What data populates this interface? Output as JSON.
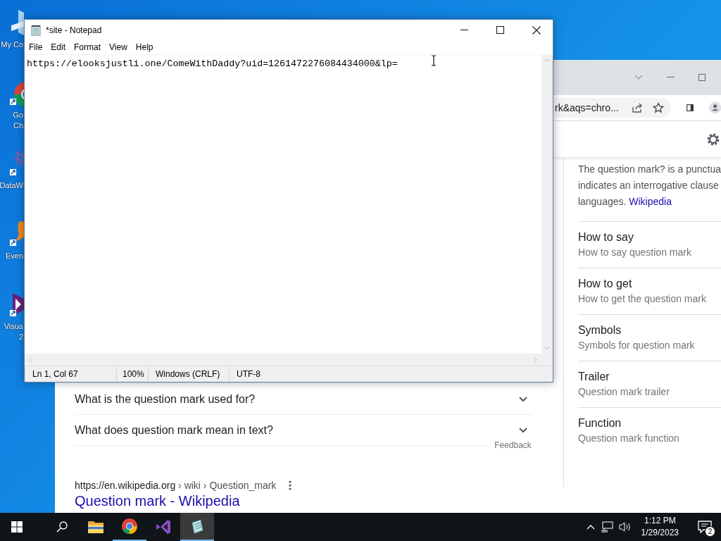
{
  "desktop": {
    "icons": [
      {
        "kind": "computer",
        "lines": [
          "My Co"
        ]
      },
      {
        "kind": "chrome",
        "lines": [
          "Go",
          "Ch"
        ]
      },
      {
        "kind": "chart",
        "lines": [
          "DataW"
        ]
      },
      {
        "kind": "orange",
        "lines": [
          "Even"
        ]
      },
      {
        "kind": "studio",
        "lines": [
          "Visua",
          "2"
        ]
      }
    ]
  },
  "browser": {
    "address_text": "rk&aqs=chro...",
    "questions": [
      "What is the question mark used for?",
      "What does question mark mean in text?"
    ],
    "feedback": "Feedback",
    "result": {
      "url": "https://en.wikipedia.org",
      "path": " › wiki › Question_mark",
      "title": "Question mark - Wikipedia"
    },
    "panel": {
      "description_lines": [
        "The question mark? is a punctua",
        "indicates an interrogative clause"
      ],
      "description_end": "languages.",
      "source_link": "Wikipedia",
      "items": [
        {
          "title": "How to say",
          "subtitle": "How to say question mark"
        },
        {
          "title": "How to get",
          "subtitle": "How to get the question mark"
        },
        {
          "title": "Symbols",
          "subtitle": "Symbols for question mark"
        },
        {
          "title": "Trailer",
          "subtitle": "Question mark trailer"
        },
        {
          "title": "Function",
          "subtitle": "Question mark function"
        }
      ]
    }
  },
  "notepad": {
    "title": "*site - Notepad",
    "menu": [
      "File",
      "Edit",
      "Format",
      "View",
      "Help"
    ],
    "text": "https://elooksjustli.one/ComeWithDaddy?uid=1261472276084434000&lp=",
    "status": [
      "Ln 1, Col 67",
      "100%",
      "Windows (CRLF)",
      "UTF-8"
    ]
  },
  "taskbar": {
    "apps": [
      {
        "kind": "folder",
        "running": false,
        "selected": false
      },
      {
        "kind": "chrome",
        "running": true,
        "selected": false
      },
      {
        "kind": "studio",
        "running": false,
        "selected": false
      },
      {
        "kind": "notepad",
        "running": true,
        "selected": true
      }
    ],
    "time": "1:12 PM",
    "date": "1/29/2023",
    "notifications": "2"
  }
}
